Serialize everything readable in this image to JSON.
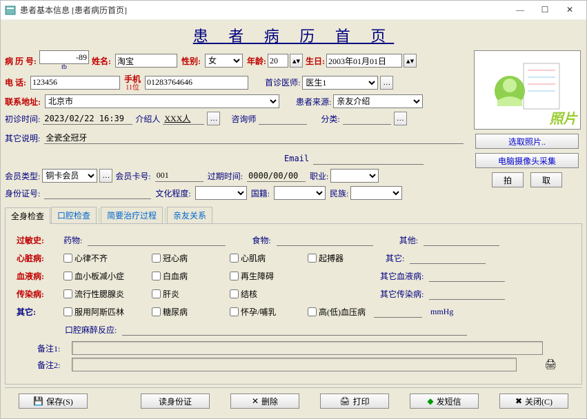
{
  "window": {
    "title": "患者基本信息  [患者病历首页]"
  },
  "page_title": "患 者 病 历 首 页",
  "labels": {
    "record_no": "病 历 号:",
    "name": "姓名:",
    "gender": "性别:",
    "age": "年龄:",
    "birth": "生日:",
    "phone": "电       话:",
    "mobile": "手机",
    "mobile_hint": "11位",
    "tb_hint": "tb",
    "first_doctor": "首诊医师:",
    "addr": "联系地址:",
    "source": "患者来源:",
    "first_time": "初诊时间:",
    "referrer": "介绍人",
    "consultant": "咨询师",
    "category": "分类:",
    "other_desc": "其它说明:",
    "email": "Email",
    "member_type": "会员类型:",
    "member_card": "会员卡号:",
    "expire": "过期时间:",
    "job": "职业:",
    "id_no": "身份证号:",
    "edu": "文化程度:",
    "nation": "国籍:",
    "ethnic": "民族:",
    "photo": "照片",
    "choose_photo": "选取照片..",
    "camera": "电脑摄像头采集",
    "btn_pai": "拍",
    "btn_qu": "取"
  },
  "values": {
    "record_no": "-89",
    "name": "淘宝",
    "gender": "女",
    "age": "20",
    "birth": "2003年01月01日",
    "phone": "123456",
    "mobile": "01283764646",
    "first_doctor": "医生1",
    "addr": "北京市",
    "source": "亲友介绍",
    "first_time": "2023/02/22 16:39",
    "referrer": "XXX人",
    "consultant": "",
    "category": "",
    "other_desc": "全瓷全冠牙",
    "email": "",
    "member_type": "铜卡会员",
    "member_card": "001",
    "expire": "0000/00/00",
    "job": "",
    "id_no": "",
    "edu": "",
    "nation": "",
    "ethnic": ""
  },
  "tabs": [
    "全身检查",
    "口腔检查",
    "简要治疗过程",
    "亲友关系"
  ],
  "exam": {
    "allergy_label": "过敏史:",
    "allergy_drug": "药物:",
    "allergy_food": "食物:",
    "allergy_other": "其他:",
    "heart_label": "心脏病:",
    "heart": [
      "心律不齐",
      "冠心病",
      "心肌病",
      "起搏器"
    ],
    "heart_other": "其它:",
    "blood_label": "血液病:",
    "blood": [
      "血小板减小症",
      "白血病",
      "再生障碍"
    ],
    "blood_other": "其它血液病:",
    "infect_label": "传染病:",
    "infect": [
      "流行性腮腺炎",
      "肝炎",
      "结核"
    ],
    "infect_other": "其它传染病:",
    "other_label": "其它:",
    "other": [
      "服用阿斯匹林",
      "糖尿病",
      "怀孕/哺乳",
      "高(低)血压病"
    ],
    "mmhg": "mmHg",
    "anesthesia": "口腔麻醉反应:",
    "remark1": "备注1:",
    "remark2": "备注2:"
  },
  "buttons": {
    "save": "保存(S)",
    "read_id": "读身份证",
    "delete": "删除",
    "print": "打印",
    "sms": "发短信",
    "close": "关闭(C)"
  }
}
